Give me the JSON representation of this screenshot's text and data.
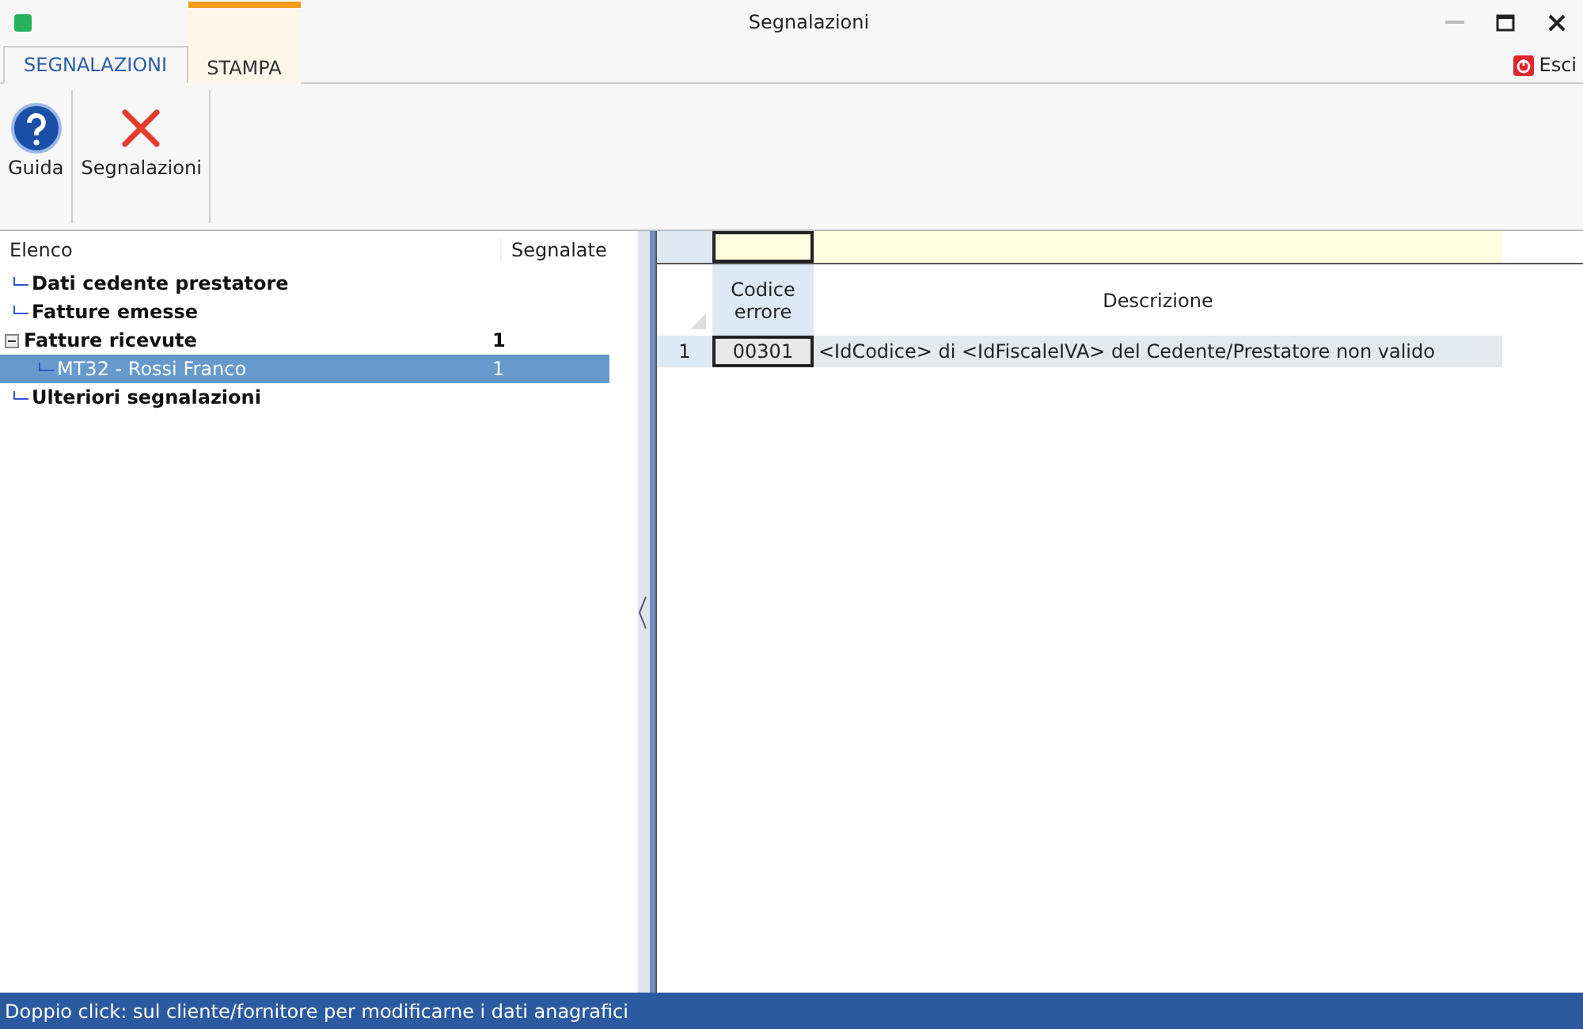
{
  "window": {
    "title": "Segnalazioni"
  },
  "tabs": [
    {
      "label": "SEGNALAZIONI",
      "selected": true
    },
    {
      "label": "STAMPA",
      "selected": false
    }
  ],
  "exit_button": {
    "label": "Esci"
  },
  "ribbon": [
    {
      "kind": "help",
      "label": "Guida"
    },
    {
      "kind": "delete",
      "label": "Segnalazioni"
    }
  ],
  "tree": {
    "columns": [
      "Elenco",
      "Segnalate"
    ],
    "items": [
      {
        "label": "Dati cedente prestatore",
        "selected": false
      },
      {
        "label": "Fatture emesse",
        "selected": false
      },
      {
        "label": "Fatture ricevute",
        "count": "1",
        "expanded": true,
        "selected": false,
        "children": [
          {
            "label": "MT32 - Rossi Franco",
            "count": "1",
            "selected": true
          }
        ]
      },
      {
        "label": "Ulteriori segnalazioni",
        "selected": false
      }
    ]
  },
  "grid": {
    "columns": [
      "Codice errore",
      "Descrizione"
    ],
    "rows": [
      {
        "number": "1",
        "code": "00301",
        "description": "<IdCodice> di <IdFiscaleIVA> del Cedente/Prestatore non valido"
      }
    ]
  },
  "status_bar": "Doppio click: sul cliente/fornitore per modificarne i dati anagrafici"
}
